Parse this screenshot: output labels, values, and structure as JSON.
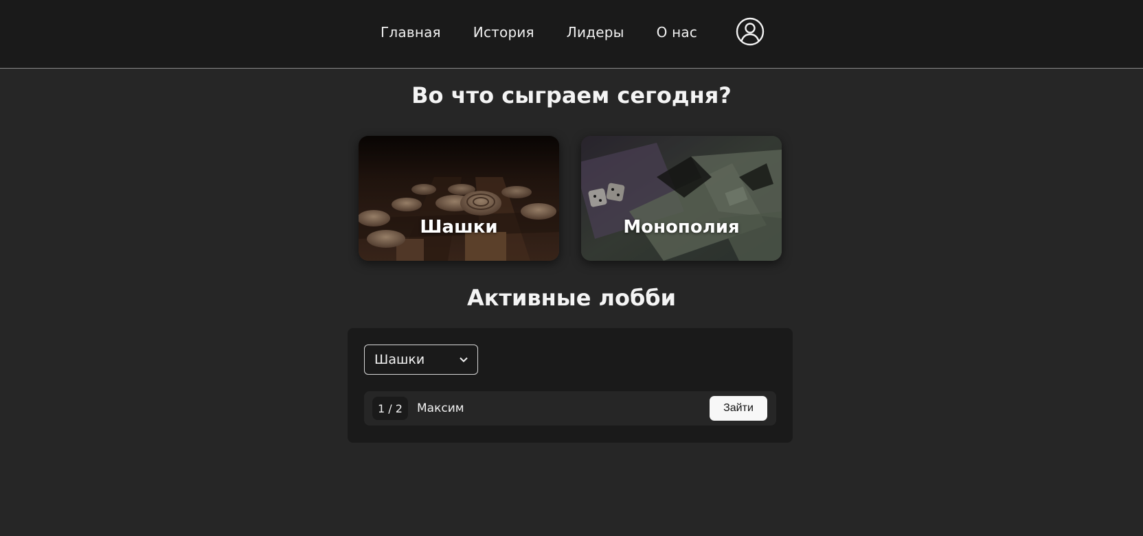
{
  "nav": {
    "items": [
      {
        "label": "Главная"
      },
      {
        "label": "История"
      },
      {
        "label": "Лидеры"
      },
      {
        "label": "О нас"
      }
    ],
    "profile_icon": "user-circle-icon"
  },
  "main": {
    "title": "Во что сыграем сегодня?",
    "games": [
      {
        "label": "Шашки",
        "image": "checkers-board-photo"
      },
      {
        "label": "Монополия",
        "image": "monopoly-money-photo"
      }
    ]
  },
  "lobbies": {
    "title": "Активные лобби",
    "selected_game": "Шашки",
    "rows": [
      {
        "count": "1 / 2",
        "player": "Максим",
        "join_label": "Зайти"
      }
    ]
  },
  "colors": {
    "background": "#262626",
    "header": "#1a1a1a",
    "panel": "#1a1a1a",
    "text": "#f2f2f2"
  }
}
